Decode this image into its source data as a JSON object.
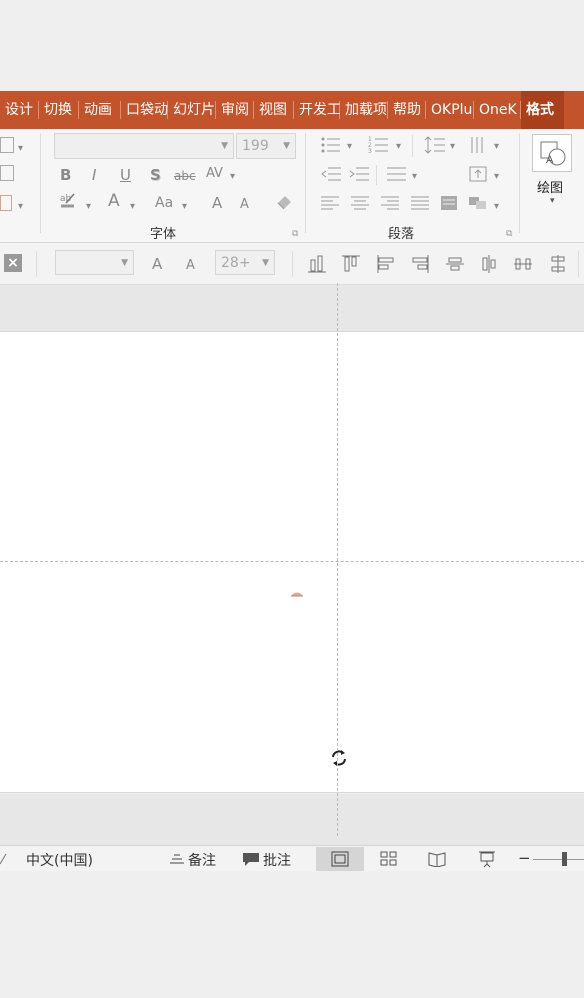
{
  "ribbon_tabs": [
    {
      "label": "设计"
    },
    {
      "label": "切换"
    },
    {
      "label": "动画"
    },
    {
      "label": "口袋动"
    },
    {
      "label": "幻灯片"
    },
    {
      "label": "审阅"
    },
    {
      "label": "视图"
    },
    {
      "label": "开发工"
    },
    {
      "label": "加载项"
    },
    {
      "label": "帮助"
    },
    {
      "label": "OKPlu"
    },
    {
      "label": "OneK"
    },
    {
      "label": "格式"
    }
  ],
  "font_group": {
    "label": "字体",
    "font_name": "",
    "font_size": "199",
    "bold": "B",
    "italic": "I",
    "underline": "U",
    "shadow": "S",
    "strikethrough": "abc",
    "char_spacing": "AV",
    "font_color": "A",
    "change_case": "Aa",
    "grow": "A",
    "shrink": "A"
  },
  "paragraph_group": {
    "label": "段落"
  },
  "drawing_group": {
    "label": "绘图"
  },
  "toolbar2": {
    "close": "×",
    "font_name": "",
    "grow": "A",
    "shrink": "A",
    "size": "28+"
  },
  "statusbar": {
    "language": "中文(中国)",
    "notes": "备注",
    "comments": "批注"
  },
  "colors": {
    "tabbar": "#c3532a",
    "active_tab": "#a9401b"
  }
}
